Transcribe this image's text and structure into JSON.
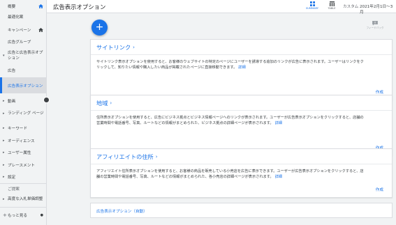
{
  "sidebar": {
    "items": [
      {
        "label": "概要",
        "home": true
      },
      {
        "label": "最適化案"
      },
      {
        "label": "キャンペーン",
        "home": true
      },
      {
        "label": "広告グループ"
      },
      {
        "label": "広告と広告表示オプション",
        "arrow": "▾"
      },
      {
        "label": "広告"
      },
      {
        "label": "広告表示オプション",
        "selected": true
      },
      {
        "label": "動画",
        "arrow": "▸"
      },
      {
        "label": "ランディング ページ",
        "arrow": "▸"
      },
      {
        "label": "キーワード",
        "arrow": "▸"
      },
      {
        "label": "オーディエンス",
        "arrow": "▸"
      },
      {
        "label": "ユーザー属性",
        "arrow": "▸"
      },
      {
        "label": "プレースメント",
        "arrow": "▸"
      },
      {
        "label": "設定",
        "arrow": "▸"
      },
      {
        "label": "ご提案"
      },
      {
        "label": "高度な入札単価調整",
        "arrow": "▸"
      },
      {
        "label": "もっと見る",
        "arrow": "+"
      }
    ]
  },
  "header": {
    "title": "広告表示オプション",
    "summary_label": "SUMMARY",
    "table_label": "TABLE",
    "custom_label": "カスタム",
    "date_range": "2021年2月1日〜3月"
  },
  "main": {
    "fab_label": "+",
    "feedback_label": "フィードバック",
    "cards": [
      {
        "title": "サイトリンク",
        "desc1": "サイトリンク表示オプションを使用すると、お客様のウェブサイトの特定のページにユーザーを誘導する追加のリンクが広告に表示されます。ユーザーはリンクをク",
        "desc2": "リックして、知りたい情報や購入したい商品が掲載されたページに直接移動できます。",
        "detail": "詳細",
        "action": "作成"
      },
      {
        "title": "地域",
        "desc1": "住所表示オプションを使用すると、広告にビジネス拠点とビジネス情報ページへのリンクが表示されます。ユーザーが広告表示オプションをクリックすると、店舗の",
        "desc2": "営業時間や電話番号、写真、ルートなどの情報がまとめられた、ビジネス拠点の詳細ページが表示されます。",
        "detail": "詳細",
        "action": "作成"
      },
      {
        "title": "アフィリエイトの住所",
        "desc1": "アフィリエイト住所表示オプションを使用すると、お客様の商品を販売している小売店を広告に表示できます。ユーザーが広告表示オプションをクリックすると、店",
        "desc2": "舗の営業時間や電話番号、写真、ルートなどの情報がまとめられた、各小売店の詳細ページが表示されます。",
        "detail": "詳細",
        "action": "作成"
      }
    ],
    "auto_link": "広告表示オプション（自動）"
  },
  "colors": {
    "accent": "#1a73e8",
    "selected_bg": "#dadce0",
    "page_bg": "#f1f3f4"
  },
  "icons": {
    "home": "home-icon",
    "summary": "summary-icon",
    "table": "table-icon",
    "feedback": "feedback-icon",
    "chevron": "chevron-right-icon"
  }
}
